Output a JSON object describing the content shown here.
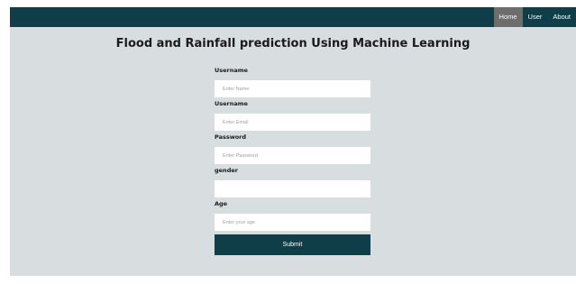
{
  "nav": {
    "items": [
      {
        "label": "Home",
        "active": true
      },
      {
        "label": "User",
        "active": false
      },
      {
        "label": "About",
        "active": false
      }
    ]
  },
  "page_title": "Flood and Rainfall prediction Using Machine Learning",
  "form": {
    "fields": [
      {
        "label": "Username",
        "placeholder": "Enter Name",
        "value": ""
      },
      {
        "label": "Username",
        "placeholder": "Enter Email",
        "value": ""
      },
      {
        "label": "Password",
        "placeholder": "Enter Password",
        "value": ""
      },
      {
        "label": "gender",
        "placeholder": "",
        "value": ""
      },
      {
        "label": "Age",
        "placeholder": "Enter your age",
        "value": ""
      }
    ],
    "submit_label": "Submit"
  },
  "colors": {
    "navbar": "#0f3d48",
    "nav_active": "#6d6d6d",
    "background": "#d8dde0",
    "button": "#0f3d48"
  }
}
